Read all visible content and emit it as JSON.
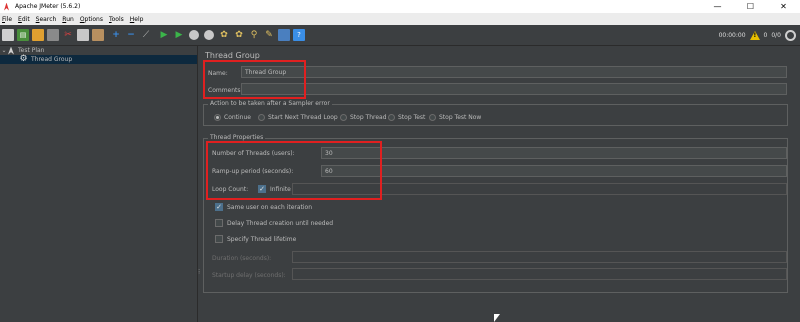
{
  "window": {
    "title": "Apache JMeter (5.6.2)",
    "minimize": "—",
    "maximize": "☐",
    "close": "✕"
  },
  "menu": [
    "File",
    "Edit",
    "Search",
    "Run",
    "Options",
    "Tools",
    "Help"
  ],
  "menu_underline": [
    "F",
    "E",
    "S",
    "R",
    "O",
    "T",
    "H"
  ],
  "toolbar": {
    "elapsed": "00:00:00",
    "errors": "0",
    "threads": "0/0",
    "icons": [
      "new-icon",
      "templates-icon",
      "open-icon",
      "save-icon",
      "cut-icon",
      "copy-icon",
      "paste-icon",
      "expand-icon",
      "collapse-icon",
      "toggle-icon",
      "start-icon",
      "start-no-pauses-icon",
      "stop-icon",
      "shutdown-icon",
      "clear-icon",
      "clear-all-icon",
      "search-icon",
      "reset-search-icon",
      "function-helper-icon",
      "help-icon"
    ],
    "accent": "#4caf50"
  },
  "tree": {
    "items": [
      {
        "label": "Test Plan",
        "icon": "test-plan-icon",
        "expanded": true
      },
      {
        "label": "Thread Group",
        "icon": "gear-icon",
        "selected": true
      }
    ]
  },
  "panel": {
    "title": "Thread Group",
    "name_label": "Name:",
    "name_value": "Thread Group",
    "comments_label": "Comments:",
    "comments_value": "",
    "sampler_error_title": "Action to be taken after a Sampler error",
    "sampler_error_options": [
      {
        "label": "Continue",
        "selected": true
      },
      {
        "label": "Start Next Thread Loop",
        "selected": false
      },
      {
        "label": "Stop Thread",
        "selected": false
      },
      {
        "label": "Stop Test",
        "selected": false
      },
      {
        "label": "Stop Test Now",
        "selected": false
      }
    ],
    "thread_props_title": "Thread Properties",
    "threads_label": "Number of Threads (users):",
    "threads_value": "30",
    "rampup_label": "Ramp-up period (seconds):",
    "rampup_value": "60",
    "loop_label": "Loop Count:",
    "infinite_label": "Infinite",
    "infinite_checked": true,
    "loop_value": "",
    "same_user_label": "Same user on each iteration",
    "same_user_checked": true,
    "delay_label": "Delay Thread creation until needed",
    "delay_checked": false,
    "lifetime_label": "Specify Thread lifetime",
    "lifetime_checked": false,
    "duration_label": "Duration (seconds):",
    "duration_value": "",
    "startup_label": "Startup delay (seconds):",
    "startup_value": ""
  },
  "highlight_color": "#e02020"
}
